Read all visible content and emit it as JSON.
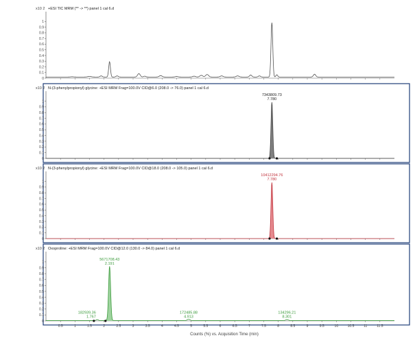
{
  "xaxis": {
    "label": "Counts (%) vs. Acquisition Time (min)",
    "ticks": [
      "0.5",
      "1",
      "1.5",
      "2",
      "2.5",
      "3",
      "3.5",
      "4",
      "4.5",
      "5",
      "5.5",
      "6",
      "6.5",
      "7",
      "7.5",
      "8",
      "8.5",
      "9",
      "9.5",
      "10",
      "10.5",
      "11",
      "11.5"
    ]
  },
  "y_exponent_label": "x10 2",
  "y_ticks": [
    "0",
    "0.1",
    "0.2",
    "0.3",
    "0.4",
    "0.5",
    "0.6",
    "0.7",
    "0.8",
    "0.9",
    "1"
  ],
  "chart_data": [
    {
      "type": "line",
      "title": "+ESI TIC MRM (** -> **) panel 1 cal 6.d",
      "xlim": [
        0,
        12
      ],
      "ylim": [
        0,
        1.15
      ],
      "color": "#505050",
      "series": [
        {
          "baseline": 0.02,
          "peaks": [
            {
              "x": 0.9,
              "y": 0.005,
              "w": 0.05
            },
            {
              "x": 1.5,
              "y": 0.012,
              "w": 0.06
            },
            {
              "x": 1.9,
              "y": 0.02,
              "w": 0.04
            },
            {
              "x": 2.19,
              "y": 0.27,
              "w": 0.03
            },
            {
              "x": 2.45,
              "y": 0.02,
              "w": 0.04
            },
            {
              "x": 3.2,
              "y": 0.06,
              "w": 0.045
            },
            {
              "x": 3.4,
              "y": 0.015,
              "w": 0.04
            },
            {
              "x": 3.95,
              "y": 0.025,
              "w": 0.05
            },
            {
              "x": 4.5,
              "y": 0.01,
              "w": 0.05
            },
            {
              "x": 5.1,
              "y": 0.015,
              "w": 0.05
            },
            {
              "x": 5.35,
              "y": 0.03,
              "w": 0.05
            },
            {
              "x": 5.55,
              "y": 0.045,
              "w": 0.05
            },
            {
              "x": 6.05,
              "y": 0.02,
              "w": 0.05
            },
            {
              "x": 6.6,
              "y": 0.02,
              "w": 0.05
            },
            {
              "x": 7.05,
              "y": 0.035,
              "w": 0.04
            },
            {
              "x": 7.35,
              "y": 0.02,
              "w": 0.04
            },
            {
              "x": 7.78,
              "y": 0.96,
              "w": 0.03
            },
            {
              "x": 7.95,
              "y": 0.04,
              "w": 0.03
            },
            {
              "x": 9.25,
              "y": 0.05,
              "w": 0.04
            }
          ]
        }
      ],
      "annotations": []
    },
    {
      "type": "line",
      "title": "N-(3-phenylpropionyl) glycine: +ESI MRM Frag=100.0V CID@6.0 (208.0 -> 76.0) panel 1 cal 6.d",
      "xlim": [
        0,
        12
      ],
      "ylim": [
        0,
        1.15
      ],
      "color": "#404040",
      "fill": "#808080",
      "series": [
        {
          "baseline": 0,
          "peaks": [
            {
              "x": 7.78,
              "y": 0.98,
              "w": 0.03
            }
          ]
        }
      ],
      "annotations": [
        {
          "x": 7.78,
          "y": 0.98,
          "area": "7343809.73",
          "rt": "7.780",
          "color": "#202020"
        }
      ],
      "markers": [
        7.7,
        7.95
      ]
    },
    {
      "type": "line",
      "title": "N-(3-phenylpropionyl) glycine: +ESI MRM Frag=100.0V CID@18.0 (208.0 -> 105.0) panel 1 cal 6.d",
      "xlim": [
        0,
        12
      ],
      "ylim": [
        0,
        1.15
      ],
      "color": "#c0303a",
      "fill": "#e58a8f",
      "series": [
        {
          "baseline": 0,
          "peaks": [
            {
              "x": 7.78,
              "y": 0.98,
              "w": 0.03
            }
          ]
        }
      ],
      "annotations": [
        {
          "x": 7.78,
          "y": 0.98,
          "area": "10412294.76",
          "rt": "7.780",
          "color": "#c0303a"
        }
      ],
      "markers": [
        7.7,
        7.95
      ]
    },
    {
      "type": "line",
      "title": "Oxoproline: +ESI MRM Frag=100.0V CID@12.0 (130.0 -> 84.0) panel 1 cal 6.d",
      "xlim": [
        0,
        12
      ],
      "ylim": [
        0,
        1.15
      ],
      "color": "#3a9a3a",
      "fill": "#9fd39f",
      "series": [
        {
          "baseline": 0.005,
          "peaks": [
            {
              "x": 1.767,
              "y": 0.015,
              "w": 0.04
            },
            {
              "x": 2.191,
              "y": 0.92,
              "w": 0.035
            },
            {
              "x": 4.913,
              "y": 0.02,
              "w": 0.05
            },
            {
              "x": 8.301,
              "y": 0.015,
              "w": 0.05
            }
          ]
        }
      ],
      "annotations": [
        {
          "x": 2.191,
          "y": 0.92,
          "area": "5671708.43",
          "rt": "2.191",
          "color": "#3a9a3a"
        },
        {
          "x": 1.767,
          "y": 0.015,
          "area": "182939.36",
          "rt": "1.767",
          "color": "#3a9a3a",
          "align": "left"
        },
        {
          "x": 4.913,
          "y": 0.02,
          "area": "172485.88",
          "rt": "4.913",
          "color": "#3a9a3a"
        },
        {
          "x": 8.301,
          "y": 0.015,
          "area": "134296.21",
          "rt": "8.301",
          "color": "#3a9a3a"
        }
      ],
      "markers": [
        1.65,
        2.05
      ]
    }
  ]
}
